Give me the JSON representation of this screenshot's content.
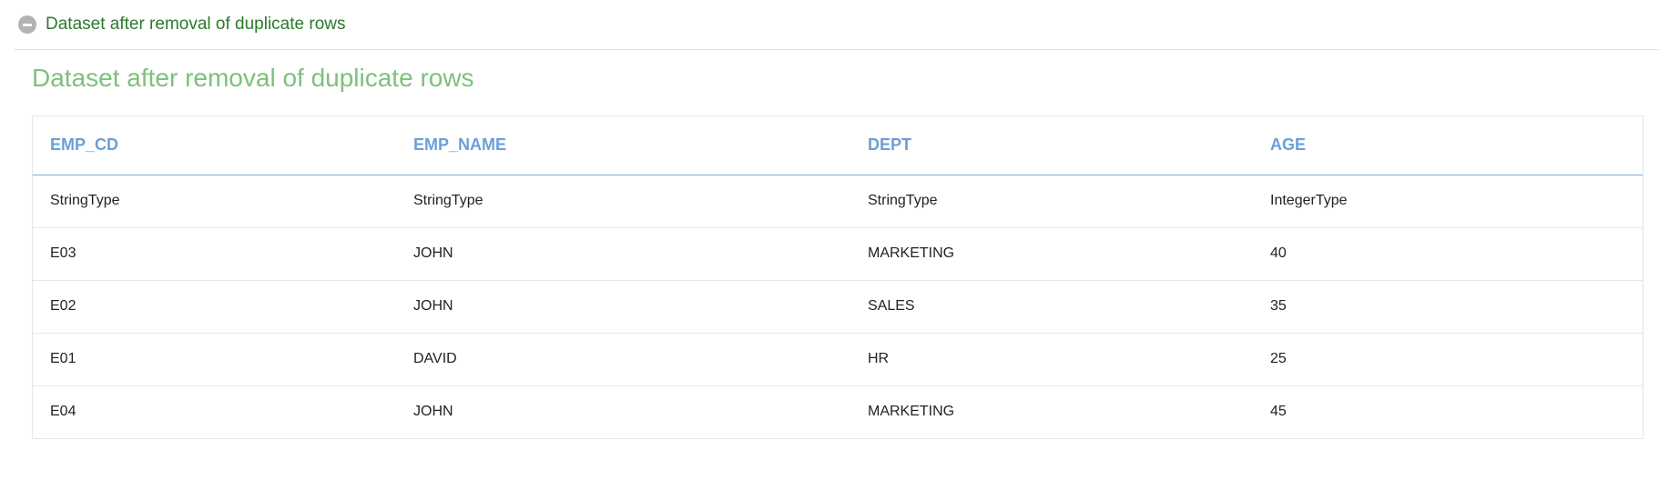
{
  "section": {
    "header_label": "Dataset after removal of duplicate rows",
    "icon": "minus-circle-icon",
    "title": "Dataset after removal of duplicate rows"
  },
  "table": {
    "columns": [
      "EMP_CD",
      "EMP_NAME",
      "DEPT",
      "AGE"
    ],
    "types": [
      "StringType",
      "StringType",
      "StringType",
      "IntegerType"
    ],
    "rows": [
      [
        "E03",
        "JOHN",
        "MARKETING",
        "40"
      ],
      [
        "E02",
        "JOHN",
        "SALES",
        "35"
      ],
      [
        "E01",
        "DAVID",
        "HR",
        "25"
      ],
      [
        "E04",
        "JOHN",
        "MARKETING",
        "45"
      ]
    ]
  },
  "colors": {
    "header_link": "#2b7a2b",
    "title": "#7ec07e",
    "column_header": "#6b9fd6"
  }
}
